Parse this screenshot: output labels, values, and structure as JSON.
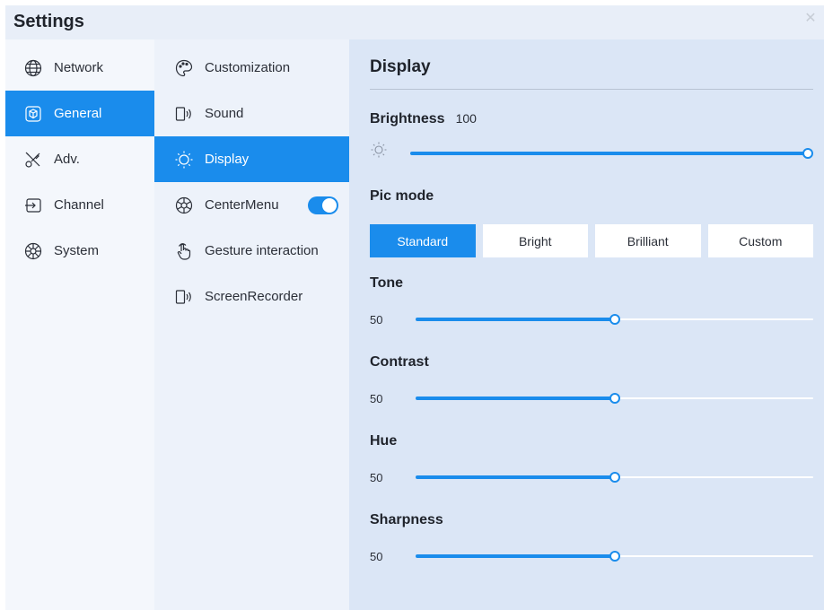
{
  "window": {
    "title": "Settings",
    "close_icon": "close-icon"
  },
  "categories": [
    {
      "label": "Network",
      "icon": "globe-icon",
      "active": false
    },
    {
      "label": "General",
      "icon": "cube-icon",
      "active": true
    },
    {
      "label": "Adv.",
      "icon": "tools-icon",
      "active": false
    },
    {
      "label": "Channel",
      "icon": "input-icon",
      "active": false
    },
    {
      "label": "System",
      "icon": "system-icon",
      "active": false
    }
  ],
  "submenu": [
    {
      "label": "Customization",
      "icon": "palette-icon",
      "active": false
    },
    {
      "label": "Sound",
      "icon": "speaker-icon",
      "active": false
    },
    {
      "label": "Display",
      "icon": "sun-icon",
      "active": true
    },
    {
      "label": "CenterMenu",
      "icon": "aperture-icon",
      "active": false,
      "toggle_on": true
    },
    {
      "label": "Gesture interaction",
      "icon": "hand-icon",
      "active": false
    },
    {
      "label": "ScreenRecorder",
      "icon": "speaker-icon",
      "active": false
    }
  ],
  "display": {
    "title": "Display",
    "brightness": {
      "label": "Brightness",
      "value": "100",
      "level": 100
    },
    "pic_mode": {
      "label": "Pic mode",
      "options": [
        "Standard",
        "Bright",
        "Brilliant",
        "Custom"
      ],
      "selected": "Standard"
    },
    "tone": {
      "label": "Tone",
      "value": "50",
      "level": 50
    },
    "contrast": {
      "label": "Contrast",
      "value": "50",
      "level": 50
    },
    "hue": {
      "label": "Hue",
      "value": "50",
      "level": 50
    },
    "sharpness": {
      "label": "Sharpness",
      "value": "50",
      "level": 50
    }
  },
  "colors": {
    "accent": "#1a8cec",
    "panel": "#dbe6f6"
  }
}
